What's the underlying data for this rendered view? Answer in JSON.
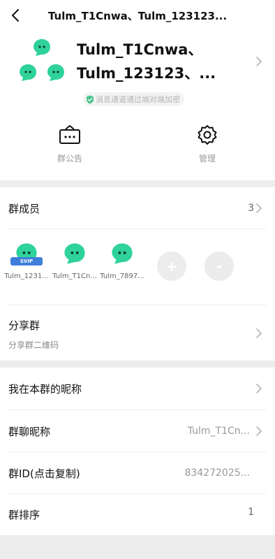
{
  "header": {
    "title": "Tulm_T1Cnwa、Tulm_123123..."
  },
  "group": {
    "name_line1": "Tulm_T1Cnwa、",
    "name_line2": "Tulm_123123、...",
    "encryption_notice": "消息通道通过端对端加密"
  },
  "actions": {
    "announcement_label": "群公告",
    "manage_label": "管理"
  },
  "members": {
    "label": "群成员",
    "count": "3",
    "items": [
      {
        "name": "Tulm_1231...",
        "badge": "SVIP"
      },
      {
        "name": "Tulm_T1Cn..."
      },
      {
        "name": "Tulm_7897..."
      }
    ],
    "add_label": "+",
    "remove_label": "-"
  },
  "share": {
    "label": "分享群",
    "sub": "分享群二维码"
  },
  "settings": {
    "my_nickname_label": "我在本群的昵称",
    "chat_nickname_label": "群聊昵称",
    "chat_nickname_value": "Tulm_T1Cn...",
    "group_id_label": "群ID(点击复制)",
    "group_id_value": "834272025...",
    "sort_label": "群排序",
    "sort_value": "1"
  },
  "colors": {
    "bubble_green": "#2fd39a",
    "background": "#ededed"
  }
}
